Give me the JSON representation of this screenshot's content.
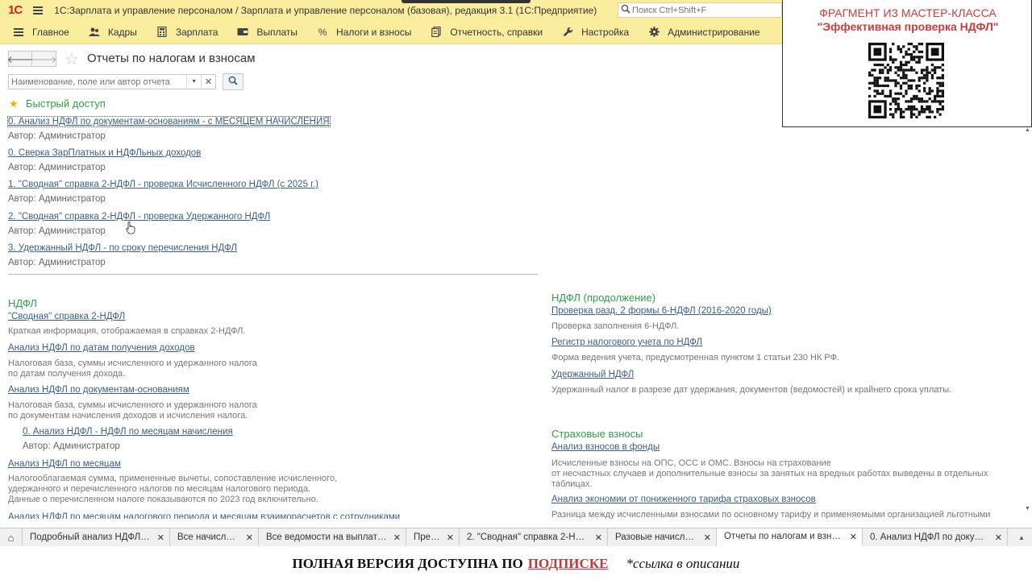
{
  "window": {
    "logo": "1С",
    "title": "1С:Зарплата и управление персоналом / Зарплата и управление персоналом (базовая), редакция 3.1  (1С:Предприятие)",
    "search_placeholder": "Поиск Ctrl+Shift+F"
  },
  "menu": [
    {
      "label": "Главное",
      "icon": "menu-lines-icon"
    },
    {
      "label": "Кадры",
      "icon": "people-icon"
    },
    {
      "label": "Зарплата",
      "icon": "calculator-icon"
    },
    {
      "label": "Выплаты",
      "icon": "wallet-icon"
    },
    {
      "label": "Налоги и взносы",
      "icon": "percent-icon"
    },
    {
      "label": "Отчетность, справки",
      "icon": "documents-icon"
    },
    {
      "label": "Настройка",
      "icon": "wrench-icon"
    },
    {
      "label": "Администрирование",
      "icon": "gear-icon"
    }
  ],
  "header": {
    "title": "Отчеты по налогам и взносам",
    "search_placeholder": "Наименование, поле или автор отчета"
  },
  "quick_access": {
    "title": "Быстрый доступ",
    "items": [
      {
        "link": "0. Анализ НДФЛ по документам-основаниям - с МЕСЯЦЕМ НАЧИСЛЕНИЯ",
        "author": "Автор: Администратор"
      },
      {
        "link": "0. Сверка ЗарПлатных и НДФЛьных доходов",
        "author": "Автор: Администратор"
      },
      {
        "link": "1. \"Сводная\" справка 2-НДФЛ - проверка Исчисленного НДФЛ (с 2025 г.)",
        "author": "Автор: Администратор"
      },
      {
        "link": "2. \"Сводная\" справка 2-НДФЛ - проверка Удержанного НДФЛ",
        "author": "Автор: Администратор"
      },
      {
        "link": "3. Удержанный НДФЛ - по сроку перечисления НДФЛ",
        "author": "Автор: Администратор"
      }
    ]
  },
  "ndfl": {
    "title": "НДФЛ",
    "r1_link": "\"Сводная\" справка 2-НДФЛ",
    "r1_desc": "Краткая информация, отображаемая в справках 2-НДФЛ.",
    "r2_link": "Анализ НДФЛ по датам получения доходов",
    "r2_desc1": "Налоговая база, суммы исчисленного и удержанного налога",
    "r2_desc2": "по датам получения дохода.",
    "r3_link": "Анализ НДФЛ по документам-основаниям",
    "r3_desc1": "Налоговая база, суммы исчисленного и удержанного налога",
    "r3_desc2": "по документам начисления доходов и исчисления налога.",
    "r3_sub_link": "0. Анализ НДФЛ - НДФЛ по месяцам начисления",
    "r3_sub_author": "Автор: Администратор",
    "r4_link": "Анализ НДФЛ по месяцам",
    "r4_desc1": "Налогооблагаемая сумма, примененные вычеты, сопоставление исчисленного,",
    "r4_desc2": "удержанного и перечисленного налогов по месяцам налогового периода.",
    "r4_desc3": "Данные о перечисленном налоге показываются по 2023 год включительно.",
    "r5_link": "Анализ НДФЛ по месяцам налогового периода и месяцам взаиморасчетов с сотрудниками"
  },
  "ndfl_cont": {
    "title": "НДФЛ (продолжение)",
    "r1_link": "Проверка разд. 2 формы 6-НДФЛ (2016-2020 годы)",
    "r1_desc": "Проверка заполнения 6-НДФЛ.",
    "r2_link": "Регистр налогового учета по НДФЛ",
    "r2_desc": "Форма ведения учета, предусмотренная пунктом 1 статьи 230 НК РФ.",
    "r3_link": "Удержанный НДФЛ",
    "r3_desc": "Удержанный налог в разрезе дат удержания, документов (ведомостей) и крайнего срока уплаты."
  },
  "insurance": {
    "title": "Страховые взносы",
    "r1_link": "Анализ взносов в фонды",
    "r1_desc1": "Исчисленные взносы на ОПС, ОСС и ОМС. Взносы на страхование",
    "r1_desc2": "от несчастных случаев и дополнительные взносы за занятых на вредных работах выведены в отдельных",
    "r1_desc3": "таблицах.",
    "r2_link": "Анализ экономии от пониженного тарифа страховых взносов",
    "r2_desc": "Разница между исчисленными взносами по основному тарифу и применяемыми организацией льготными"
  },
  "promo": {
    "line1": "ФРАГМЕНТ ИЗ МАСТЕР-КЛАССА",
    "line2": "\"Эффективная проверка НДФЛ\""
  },
  "tabs": [
    {
      "label": "Подробный анализ НДФЛ п...",
      "active": false
    },
    {
      "label": "Все начисления",
      "active": false
    },
    {
      "label": "Все ведомости на выплату ...",
      "active": false
    },
    {
      "label": "Премии",
      "active": false
    },
    {
      "label": "2. \"Сводная\" справка 2-НД...",
      "active": false
    },
    {
      "label": "Разовые начисления",
      "active": false
    },
    {
      "label": "Отчеты по налогам и взносам",
      "active": true
    },
    {
      "label": "0. Анализ НДФЛ по докумен...",
      "active": false
    }
  ],
  "banner": {
    "main": "ПОЛНАЯ ВЕРСИЯ ДОСТУПНА ПО",
    "link": "ПОДПИСКЕ",
    "note": "*ссылка в описании"
  },
  "colors": {
    "panel_yellow": "#fbed9e",
    "section_green": "#2e9f4a",
    "link_blue": "#3a5e8c",
    "logo_red": "#d21f1f",
    "promo_red": "#d03a3a"
  }
}
